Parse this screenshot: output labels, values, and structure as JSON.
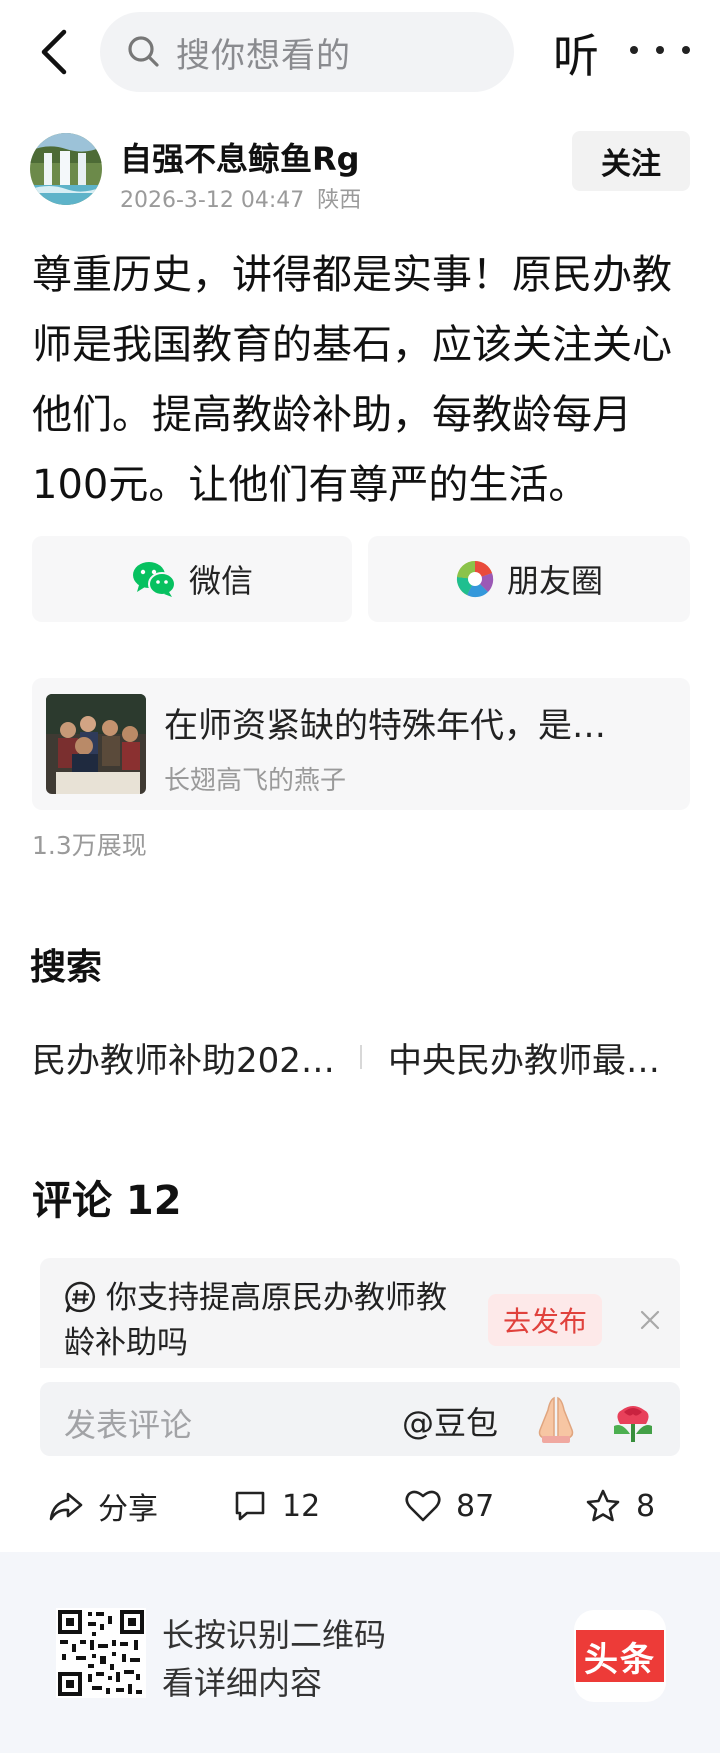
{
  "topbar": {
    "search_placeholder": "搜你想看的",
    "listen_label": "听"
  },
  "author": {
    "name": "自强不息鲸鱼Rg",
    "datetime": "2026-3-12 04:47",
    "location": "陕西",
    "follow_label": "关注"
  },
  "post": {
    "text": "尊重历史，讲得都是实事！原民办教师是我国教育的基石，应该关注关心他们。提高教龄补助，每教龄每月100元。让他们有尊严的生活。"
  },
  "share": {
    "wechat_label": "微信",
    "moments_label": "朋友圈"
  },
  "linked_article": {
    "title": "在师资紧缺的特殊年代，是…",
    "author": "长翅高飞的燕子"
  },
  "impressions": "1.3万展现",
  "search": {
    "heading": "搜索",
    "suggestions": [
      "民办教师补助202…",
      "中央民办教师最…"
    ]
  },
  "comments": {
    "heading": "评论 12",
    "topic_text": "你支持提高原民办教师教龄补助吗",
    "topic_post_label": "去发布",
    "input_placeholder": "发表评论",
    "at_mention": "@豆包"
  },
  "actions": {
    "share_label": "分享",
    "comment_count": "12",
    "like_count": "87",
    "favorite_count": "8"
  },
  "footer": {
    "line1": "长按识别二维码",
    "line2": "看详细内容",
    "app_logo_text": "头条"
  },
  "colors": {
    "brand_red": "#ed3b38",
    "post_button_text": "#e0413c",
    "wechat_green": "#07c160"
  }
}
